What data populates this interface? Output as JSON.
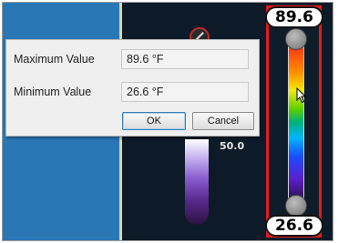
{
  "dialog": {
    "max_label": "Maximum Value",
    "max_value": "89.6 °F",
    "min_label": "Minimum Value",
    "min_value": "26.6 °F",
    "ok_label": "OK",
    "cancel_label": "Cancel"
  },
  "scale": {
    "max_display": "89.6",
    "min_display": "26.6",
    "highlight_color": "#e41b1b"
  },
  "background": {
    "bar_label": "50.0"
  },
  "colors": {
    "left_panel": "#2a77b6",
    "dark_panel": "#0d1b28"
  }
}
